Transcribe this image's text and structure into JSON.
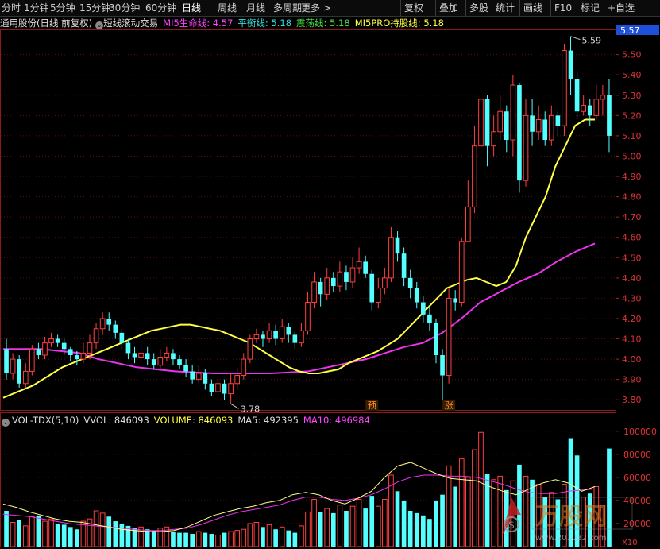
{
  "toolbar": {
    "periods": [
      "分时",
      "1分钟",
      "5分钟",
      "15分钟",
      "30分钟",
      "60分钟",
      "日线",
      "周线",
      "月线",
      "多周期",
      "更多 >"
    ],
    "active_period": "日线",
    "right_buttons": [
      "复权",
      "叠加",
      "多股",
      "统计",
      "画线",
      "F10",
      "标记",
      "+自选"
    ]
  },
  "info": {
    "stock": "通用股份(日线 前复权)",
    "indicator_name": "短线滚动交易",
    "lines": [
      {
        "label": "MI5生命线: 4.57",
        "color": "#ff44ff"
      },
      {
        "label": "平衡线: 5.18",
        "color": "#33dddd"
      },
      {
        "label": "震荡线: 5.18",
        "color": "#44dd44"
      },
      {
        "label": "MI5PRO持股线: 5.18",
        "color": "#ffff44"
      }
    ]
  },
  "price_axis": {
    "ticks": [
      "5.50",
      "5.40",
      "5.30",
      "5.20",
      "5.10",
      "5.00",
      "4.90",
      "4.80",
      "4.70",
      "4.60",
      "4.50",
      "4.40",
      "4.30",
      "4.20",
      "4.10",
      "4.00",
      "3.90",
      "3.80"
    ],
    "current": "5.57",
    "max_label": "5.59",
    "min_label": "3.78"
  },
  "signals": [
    {
      "label": "预"
    },
    {
      "label": "涨"
    }
  ],
  "volume": {
    "title": "VOL-TDX(5,10)",
    "items": [
      {
        "label": "VVOL: 846093",
        "color": "#dddddd"
      },
      {
        "label": "VOLUME: 846093",
        "color": "#ffff44"
      },
      {
        "label": "MA5: 492395",
        "color": "#dddddd"
      },
      {
        "label": "MA10: 496984",
        "color": "#ff44ff"
      }
    ],
    "ticks": [
      "100000",
      "80000",
      "60000",
      "40000",
      "20000"
    ],
    "unit": "X10"
  },
  "watermark": {
    "brand": "万股网",
    "url": "www.201032.com"
  },
  "chart_data": {
    "type": "candlestick",
    "price_range": [
      3.75,
      5.62
    ],
    "volume_range": [
      0,
      104000
    ],
    "candles": [
      [
        4.05,
        3.93,
        4.1,
        3.9
      ],
      [
        3.93,
        4.0,
        4.03,
        3.9
      ],
      [
        4.0,
        3.88,
        4.02,
        3.86
      ],
      [
        3.88,
        3.94,
        3.98,
        3.86
      ],
      [
        3.94,
        4.05,
        4.07,
        3.92
      ],
      [
        4.05,
        4.02,
        4.08,
        4.0
      ],
      [
        4.02,
        4.08,
        4.11,
        4.0
      ],
      [
        4.08,
        4.1,
        4.13,
        4.06
      ],
      [
        4.1,
        4.08,
        4.12,
        4.06
      ],
      [
        4.08,
        4.05,
        4.1,
        4.02
      ],
      [
        4.05,
        4.02,
        4.06,
        3.99
      ],
      [
        4.02,
        4.0,
        4.04,
        3.97
      ],
      [
        4.0,
        4.03,
        4.08,
        3.98
      ],
      [
        4.03,
        4.08,
        4.12,
        4.0
      ],
      [
        4.08,
        4.15,
        4.18,
        4.05
      ],
      [
        4.15,
        4.2,
        4.23,
        4.12
      ],
      [
        4.2,
        4.17,
        4.23,
        4.14
      ],
      [
        4.17,
        4.13,
        4.19,
        4.1
      ],
      [
        4.13,
        4.08,
        4.15,
        4.05
      ],
      [
        4.08,
        4.03,
        4.1,
        4.0
      ],
      [
        4.03,
        4.01,
        4.06,
        3.98
      ],
      [
        4.01,
        4.03,
        4.07,
        3.99
      ],
      [
        4.03,
        4.0,
        4.06,
        3.97
      ],
      [
        4.0,
        3.97,
        4.03,
        3.95
      ],
      [
        3.97,
        4.01,
        4.05,
        3.95
      ],
      [
        4.01,
        4.03,
        4.06,
        3.99
      ],
      [
        4.03,
        4.0,
        4.05,
        3.97
      ],
      [
        4.0,
        3.97,
        4.02,
        3.95
      ],
      [
        3.97,
        3.94,
        4.0,
        3.91
      ],
      [
        3.94,
        3.9,
        3.97,
        3.88
      ],
      [
        3.9,
        3.93,
        3.97,
        3.88
      ],
      [
        3.93,
        3.88,
        3.95,
        3.85
      ],
      [
        3.88,
        3.84,
        3.9,
        3.82
      ],
      [
        3.84,
        3.88,
        3.91,
        3.83
      ],
      [
        3.88,
        3.83,
        3.9,
        3.8
      ],
      [
        3.83,
        3.88,
        3.93,
        3.78
      ],
      [
        3.88,
        3.92,
        3.96,
        3.85
      ],
      [
        3.92,
        4.0,
        4.03,
        3.9
      ],
      [
        4.0,
        4.1,
        4.12,
        3.98
      ],
      [
        4.1,
        4.12,
        4.15,
        4.08
      ],
      [
        4.12,
        4.1,
        4.14,
        4.06
      ],
      [
        4.1,
        4.14,
        4.18,
        4.08
      ],
      [
        4.14,
        4.1,
        4.17,
        4.07
      ],
      [
        4.1,
        4.16,
        4.2,
        4.08
      ],
      [
        4.16,
        4.12,
        4.18,
        4.08
      ],
      [
        4.12,
        4.08,
        4.14,
        4.05
      ],
      [
        4.08,
        4.14,
        4.18,
        4.06
      ],
      [
        4.14,
        4.28,
        4.33,
        4.12
      ],
      [
        4.28,
        4.38,
        4.43,
        4.25
      ],
      [
        4.38,
        4.32,
        4.4,
        4.26
      ],
      [
        4.32,
        4.4,
        4.45,
        4.29
      ],
      [
        4.4,
        4.36,
        4.43,
        4.33
      ],
      [
        4.36,
        4.43,
        4.48,
        4.33
      ],
      [
        4.43,
        4.38,
        4.46,
        4.34
      ],
      [
        4.38,
        4.45,
        4.5,
        4.35
      ],
      [
        4.45,
        4.48,
        4.55,
        4.42
      ],
      [
        4.48,
        4.42,
        4.51,
        4.4
      ],
      [
        4.42,
        4.28,
        4.44,
        4.24
      ],
      [
        4.28,
        4.35,
        4.4,
        4.25
      ],
      [
        4.35,
        4.4,
        4.45,
        4.32
      ],
      [
        4.4,
        4.6,
        4.65,
        4.38
      ],
      [
        4.6,
        4.52,
        4.63,
        4.48
      ],
      [
        4.52,
        4.4,
        4.55,
        4.36
      ],
      [
        4.4,
        4.35,
        4.44,
        4.3
      ],
      [
        4.35,
        4.28,
        4.38,
        4.25
      ],
      [
        4.28,
        4.22,
        4.31,
        4.18
      ],
      [
        4.22,
        4.18,
        4.26,
        4.14
      ],
      [
        4.18,
        4.02,
        4.2,
        3.98
      ],
      [
        4.02,
        3.92,
        4.05,
        3.8
      ],
      [
        3.92,
        4.3,
        4.35,
        3.88
      ],
      [
        4.3,
        4.28,
        4.34,
        4.24
      ],
      [
        4.28,
        4.58,
        4.6,
        4.26
      ],
      [
        4.58,
        4.75,
        4.88,
        4.7
      ],
      [
        4.75,
        5.05,
        5.15,
        4.72
      ],
      [
        5.05,
        5.28,
        5.45,
        5.0
      ],
      [
        5.28,
        5.05,
        5.3,
        4.95
      ],
      [
        5.05,
        5.12,
        5.2,
        5.0
      ],
      [
        5.12,
        5.22,
        5.3,
        5.08
      ],
      [
        5.22,
        5.08,
        5.25,
        5.02
      ],
      [
        5.08,
        5.35,
        5.4,
        5.0
      ],
      [
        5.35,
        4.88,
        5.36,
        4.82
      ],
      [
        4.88,
        5.2,
        5.28,
        4.85
      ],
      [
        5.2,
        5.12,
        5.28,
        5.05
      ],
      [
        5.12,
        5.18,
        5.25,
        5.08
      ],
      [
        5.18,
        5.08,
        5.22,
        5.05
      ],
      [
        5.08,
        5.2,
        5.25,
        5.05
      ],
      [
        5.2,
        5.15,
        5.22,
        5.1
      ],
      [
        5.15,
        5.52,
        5.55,
        5.1
      ],
      [
        5.52,
        5.38,
        5.59,
        5.3
      ],
      [
        5.38,
        5.22,
        5.42,
        5.18
      ],
      [
        5.22,
        5.25,
        5.3,
        5.2
      ],
      [
        5.25,
        5.2,
        5.28,
        5.15
      ],
      [
        5.2,
        5.28,
        5.35,
        5.18
      ],
      [
        5.28,
        5.3,
        5.35,
        5.2
      ],
      [
        5.3,
        5.1,
        5.38,
        5.02
      ]
    ],
    "volumes": [
      31000,
      21000,
      23000,
      18000,
      26000,
      27000,
      22000,
      24000,
      20000,
      19000,
      17000,
      15000,
      22000,
      24000,
      31000,
      29000,
      26000,
      22000,
      20000,
      18000,
      16000,
      17000,
      15000,
      14000,
      16000,
      17000,
      13000,
      12000,
      12000,
      11000,
      13000,
      12000,
      11000,
      10000,
      12000,
      13000,
      14000,
      15000,
      20000,
      21000,
      17000,
      19000,
      15000,
      17000,
      14000,
      12000,
      18000,
      30000,
      41000,
      30000,
      33000,
      29000,
      36000,
      31000,
      35000,
      41000,
      33000,
      44000,
      35000,
      41000,
      62000,
      48000,
      40000,
      31000,
      29000,
      27000,
      24000,
      40000,
      45000,
      70000,
      52000,
      76000,
      60000,
      84000,
      99000,
      63000,
      58000,
      61000,
      49000,
      57000,
      71000,
      61000,
      58000,
      54000,
      43000,
      47000,
      41000,
      54000,
      94000,
      79000,
      43000,
      46000,
      52000,
      36000,
      85000
    ],
    "ma_yellow": [
      3.81,
      3.83,
      3.85,
      3.87,
      3.9,
      3.93,
      3.96,
      3.98,
      4.0,
      4.02,
      4.04,
      4.06,
      4.08,
      4.1,
      4.12,
      4.14,
      4.15,
      4.16,
      4.17,
      4.17,
      4.16,
      4.15,
      4.14,
      4.12,
      4.1,
      4.08,
      4.05,
      4.02,
      3.99,
      3.96,
      3.94,
      3.93,
      3.93,
      3.94,
      3.95,
      3.98,
      4.0,
      4.02,
      4.04,
      4.07,
      4.1,
      4.15,
      4.2,
      4.25,
      4.3,
      4.35,
      4.37,
      4.39,
      4.4,
      4.38,
      4.36,
      4.38,
      4.46,
      4.6,
      4.7,
      4.8,
      4.95,
      5.05,
      5.15,
      5.18,
      5.18
    ],
    "ma_magenta": [
      4.05,
      4.05,
      4.05,
      4.04,
      4.03,
      4.0,
      3.98,
      3.96,
      3.95,
      3.94,
      3.935,
      3.93,
      3.93,
      3.93,
      3.93,
      3.935,
      3.94,
      3.96,
      3.98,
      4.0,
      4.03,
      4.06,
      4.08,
      4.13,
      4.2,
      4.28,
      4.33,
      4.38,
      4.42,
      4.48,
      4.53,
      4.57
    ],
    "vol_ma5": [
      37000,
      34000,
      30000,
      27000,
      24000,
      22000,
      21000,
      19000,
      17000,
      15000,
      14000,
      13000,
      13000,
      14000,
      17000,
      22000,
      27000,
      30000,
      33000,
      35000,
      38000,
      40000,
      45000,
      47000,
      45000,
      40000,
      37000,
      42000,
      48000,
      60000,
      70000,
      73000,
      68000,
      63000,
      59000,
      58000,
      57000,
      52000,
      48000,
      45000,
      50000,
      55000,
      58000,
      55000,
      48000,
      52000
    ],
    "vol_ma10": [
      28000,
      27000,
      26000,
      24000,
      22000,
      20000,
      19000,
      18000,
      17000,
      16000,
      15000,
      14000,
      14000,
      15000,
      16000,
      19000,
      23000,
      27000,
      30000,
      32000,
      34000,
      36000,
      40000,
      43000,
      43000,
      41000,
      40000,
      42000,
      45000,
      50000,
      56000,
      60000,
      62000,
      62000,
      61000,
      61000,
      60000,
      57000,
      54000,
      50000,
      47000,
      46000,
      46000,
      48000,
      49000,
      50000
    ]
  }
}
